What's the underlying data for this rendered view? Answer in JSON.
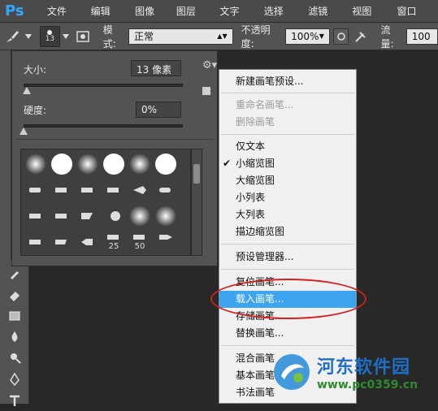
{
  "menubar": {
    "logo": "Ps",
    "items": [
      "文件(F)",
      "编辑(E)",
      "图像(I)",
      "图层(L)",
      "文字(Y)",
      "选择(S)",
      "滤镜(T)",
      "视图(V)",
      "窗口(W)"
    ]
  },
  "options": {
    "brush_size": "13",
    "mode_label": "模式:",
    "mode_value": "正常",
    "opacity_label": "不透明度:",
    "opacity_value": "100%",
    "flow_label": "流量:",
    "flow_value": "100"
  },
  "brush_panel": {
    "size_label": "大小:",
    "size_value": "13 像素",
    "size_level_fraction": 0.02,
    "hardness_label": "硬度:",
    "hardness_value": "0%",
    "hardness_level_fraction": 0.0,
    "preset_numbers": [
      "25",
      "50"
    ]
  },
  "context_menu": {
    "items": [
      {
        "label": "新建画笔预设...",
        "state": "normal"
      },
      {
        "label": "重命名画笔...",
        "state": "disabled"
      },
      {
        "label": "删除画笔",
        "state": "disabled"
      },
      {
        "label": "仅文本",
        "state": "normal"
      },
      {
        "label": "小缩览图",
        "state": "checked"
      },
      {
        "label": "大缩览图",
        "state": "normal"
      },
      {
        "label": "小列表",
        "state": "normal"
      },
      {
        "label": "大列表",
        "state": "normal"
      },
      {
        "label": "描边缩览图",
        "state": "normal"
      },
      {
        "label": "预设管理器...",
        "state": "normal"
      },
      {
        "label": "复位画笔...",
        "state": "normal"
      },
      {
        "label": "载入画笔...",
        "state": "highlighted"
      },
      {
        "label": "存储画笔...",
        "state": "normal"
      },
      {
        "label": "替换画笔...",
        "state": "normal"
      },
      {
        "label": "混合画笔",
        "state": "normal"
      },
      {
        "label": "基本画笔",
        "state": "normal"
      },
      {
        "label": "书法画笔",
        "state": "normal"
      }
    ]
  },
  "watermark": {
    "title": "河东软件园",
    "url": "www.pc0359.cn"
  },
  "colors": {
    "accent": "#3da5f0",
    "annotation": "#d32020",
    "ps_blue": "#31a8ff"
  }
}
